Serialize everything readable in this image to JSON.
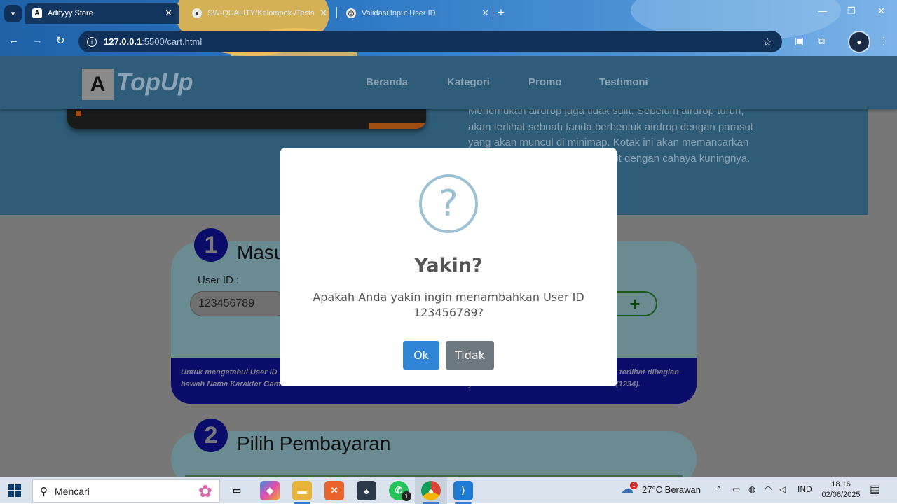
{
  "browser": {
    "tabs": [
      {
        "title": "Adityyy Store",
        "favicon": "A",
        "active": true
      },
      {
        "title": "SW-QUALITY/Kelompok-/Tests",
        "favicon": "github-icon",
        "active": false
      },
      {
        "title": "Validasi Input User ID",
        "favicon": "globe-icon",
        "active": false
      }
    ],
    "url_host": "127.0.0.1",
    "url_path": ":5500/cart.html"
  },
  "header": {
    "logo_letter": "A",
    "logo_text": "TopUp",
    "nav": [
      "Beranda",
      "Kategori",
      "Promo",
      "Testimoni"
    ]
  },
  "hero": {
    "text_lines": [
      "Menemukan airdrop juga tidak sulit. Sebelum airdrop turun,",
      "akan terlihat sebuah tanda berbentuk airdrop dengan parasut",
      "yang akan muncul di minimap. Kotak ini akan memancarkan",
      "git dengan cahaya kuningnya."
    ]
  },
  "section1": {
    "number": "1",
    "title": "Masu",
    "user_id_label": "User ID :",
    "user_id_value": "123456789",
    "add_symbol": "+",
    "info_left_1": "Untuk mengetahui User ID",
    "info_right_1": "terlihat dibagian",
    "info_line_2": "bawah Nama Karakter Game Anda. Silakan masukkan User ID Anda untuk menyelesaikan transaksi. Contoh : 12345678(1234)."
  },
  "section2": {
    "number": "2",
    "title": "Pilih Pembayaran"
  },
  "modal": {
    "icon": "?",
    "title": "Yakin?",
    "text": "Apakah Anda yakin ingin menambahkan User ID 123456789?",
    "ok_label": "Ok",
    "cancel_label": "Tidak"
  },
  "taskbar": {
    "search_label": "Mencari",
    "weather": "27°C  Berawan",
    "weather_badge": "1",
    "whatsapp_badge": "1",
    "language": "IND",
    "time": "18.16",
    "date": "02/06/2025"
  },
  "colors": {
    "modal_ok": "#3085d6",
    "modal_cancel": "#6e7881",
    "question_icon": "#9cc1d4",
    "overlay_dimmed": "#777777"
  }
}
